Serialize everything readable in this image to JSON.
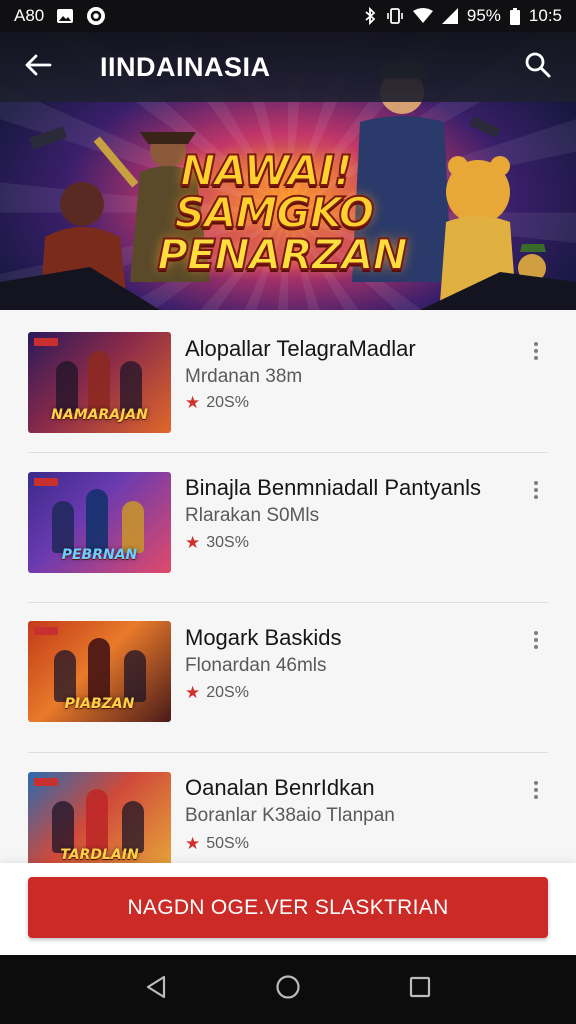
{
  "status_bar": {
    "left_text": "A80",
    "battery": "95%",
    "time": "10:5",
    "icons": [
      "image-icon",
      "circle-badge-icon",
      "bluetooth-icon",
      "vibrate-icon",
      "wifi-icon",
      "signal-icon",
      "battery-icon"
    ]
  },
  "app_bar": {
    "title": "IINDAINASIA",
    "back_icon": "arrow-left-icon",
    "search_icon": "search-icon"
  },
  "hero": {
    "title_lines": [
      "NAWAI!",
      "SAMGKO",
      "PENARZAN"
    ]
  },
  "items": [
    {
      "title": "Alopallar TelagraMadlar",
      "subtitle": "Mrdanan 38m",
      "rating": "20S%",
      "thumb_text": "NAMARAJAN"
    },
    {
      "title": "Binajla Benmniadall Pantyanls",
      "subtitle": "Rlarakan S0Mls",
      "rating": "30S%",
      "thumb_text": "PEBRNAN"
    },
    {
      "title": "Mogark Baskids",
      "subtitle": "Flonardan 46mls",
      "rating": "20S%",
      "thumb_text": "PIABZAN"
    },
    {
      "title": "Oanalan BenrIdkan",
      "subtitle": "Boranlar K38aio    Tlanpan",
      "rating": "50S%",
      "thumb_text": "TARDLAIN"
    }
  ],
  "cta": {
    "label": "NAGDN OGE.VER SLASKTRIAN"
  },
  "nav": {
    "icons": [
      "back-triangle-icon",
      "home-circle-icon",
      "recents-square-icon"
    ]
  },
  "colors": {
    "accent": "#cc2a27",
    "star": "#d0312d",
    "status_bar": "#101012",
    "nav_bar": "#0c0c0c"
  }
}
